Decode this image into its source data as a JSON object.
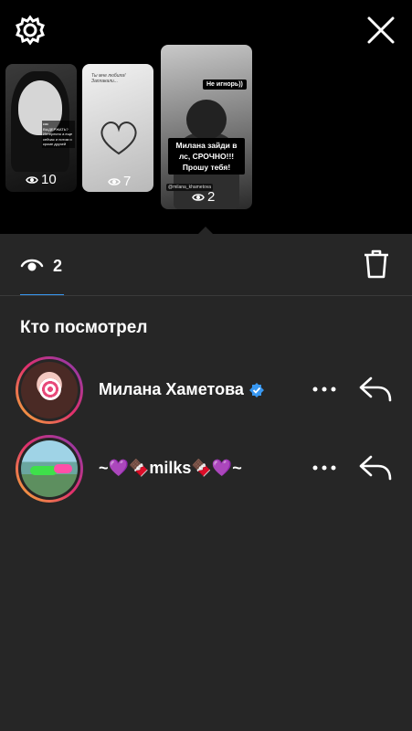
{
  "stories": [
    {
      "views": "10",
      "caption": "как ВЫДЕРЖАТЬ? Интересно а еще сейчас и потом и кроме друзей",
      "handle": "@alina_zanoza"
    },
    {
      "views": "7",
      "caption": "Ты мне любила! Заплакали..."
    },
    {
      "views": "2",
      "sticker_top": "Не игнорь))",
      "sticker_main": "Милана зайди в лс, СРОЧНО!!! Прошу тебя!",
      "handle": "@milana_khametova"
    }
  ],
  "stats": {
    "view_count": "2"
  },
  "viewers_heading": "Кто посмотрел",
  "viewers": [
    {
      "name": "Милана Хаметова",
      "verified": true
    },
    {
      "name": "~💜🍫milks🍫💜~",
      "verified": false
    }
  ],
  "colors": {
    "accent": "#3897f0",
    "sheet_bg": "#262626",
    "top_bg": "#000000"
  }
}
